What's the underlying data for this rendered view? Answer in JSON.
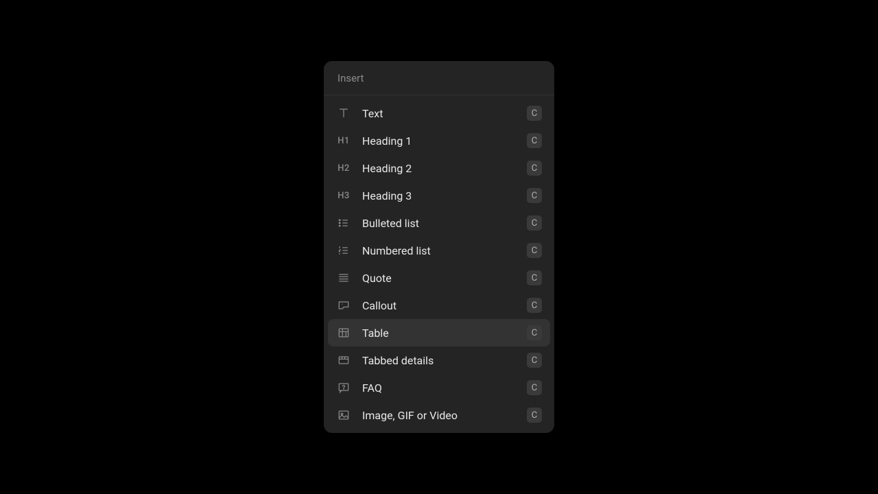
{
  "panel": {
    "title": "Insert"
  },
  "items": [
    {
      "label": "Text",
      "shortcut": "C"
    },
    {
      "label": "Heading 1",
      "shortcut": "C"
    },
    {
      "label": "Heading 2",
      "shortcut": "C"
    },
    {
      "label": "Heading 3",
      "shortcut": "C"
    },
    {
      "label": "Bulleted list",
      "shortcut": "C"
    },
    {
      "label": "Numbered list",
      "shortcut": "C"
    },
    {
      "label": "Quote",
      "shortcut": "C"
    },
    {
      "label": "Callout",
      "shortcut": "C"
    },
    {
      "label": "Table",
      "shortcut": "C"
    },
    {
      "label": "Tabbed details",
      "shortcut": "C"
    },
    {
      "label": "FAQ",
      "shortcut": "C"
    },
    {
      "label": "Image, GIF or Video",
      "shortcut": "C"
    }
  ],
  "iconLabels": {
    "h1": "H1",
    "h2": "H2",
    "h3": "H3"
  }
}
